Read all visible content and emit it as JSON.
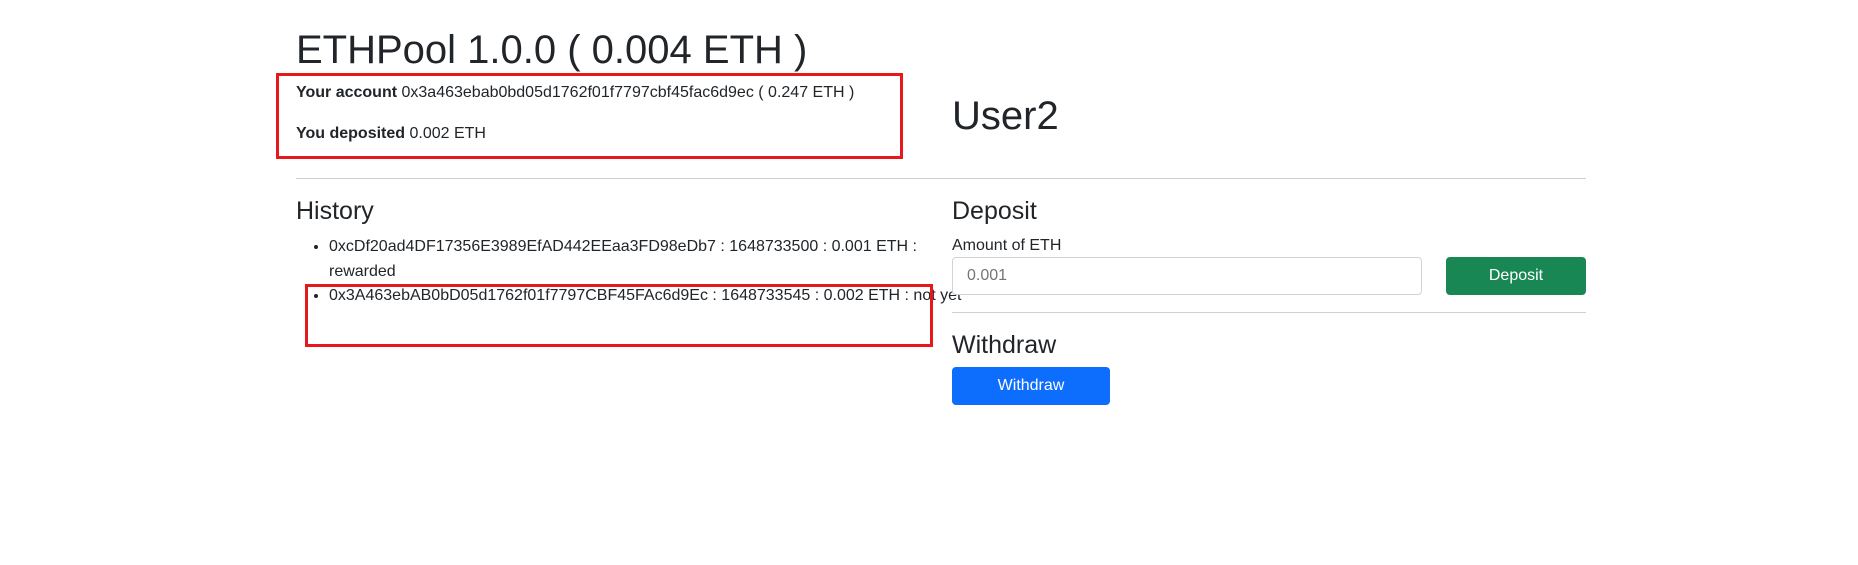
{
  "header": {
    "title": "ETHPool 1.0.0 ( 0.004 ETH )"
  },
  "account": {
    "label": "Your account",
    "address": "0x3a463ebab0bd05d1762f01f7797cbf45fac6d9ec",
    "balance": "( 0.247 ETH )"
  },
  "deposited": {
    "label": "You deposited",
    "value": "0.002 ETH"
  },
  "user": {
    "name": "User2"
  },
  "history": {
    "title": "History",
    "items": [
      {
        "text": "0xcDf20ad4DF17356E3989EfAD442EEaa3FD98eDb7 : 1648733500 : 0.001 ETH : rewarded"
      },
      {
        "text": "0x3A463ebAB0bD05d1762f01f7797CBF45FAc6d9Ec : 1648733545 : 0.002 ETH : not yet"
      }
    ]
  },
  "deposit": {
    "title": "Deposit",
    "amount_label": "Amount of ETH",
    "input_placeholder": "0.001",
    "button_label": "Deposit",
    "button_color": "#198754"
  },
  "withdraw": {
    "title": "Withdraw",
    "button_label": "Withdraw",
    "button_color": "#0d6efd"
  },
  "annotations": {
    "highlight_color": "#e8171b"
  }
}
